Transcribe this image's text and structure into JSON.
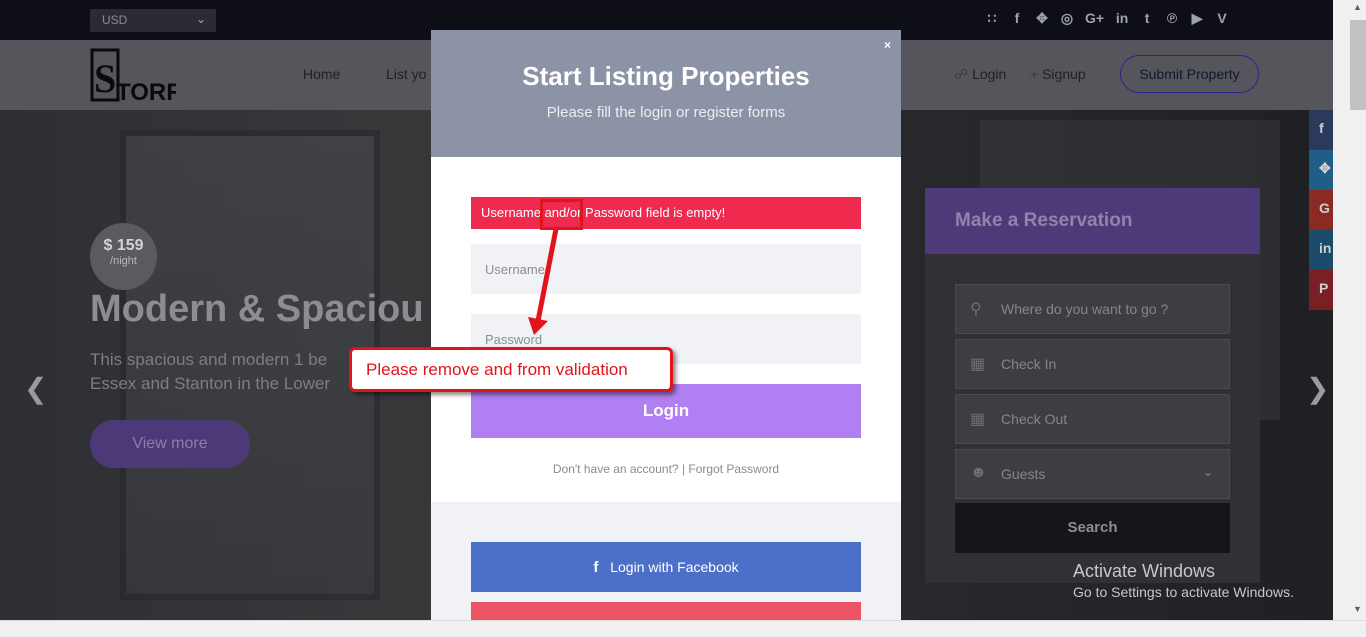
{
  "topbar": {
    "currency": "USD",
    "socials": [
      "rss-icon",
      "facebook-icon",
      "twitter-icon",
      "dribbble-icon",
      "google-plus-icon",
      "linkedin-icon",
      "tumblr-icon",
      "pinterest-icon",
      "youtube-icon",
      "vimeo-icon"
    ]
  },
  "nav": {
    "logo_text": "STORR",
    "items": [
      "Home",
      "List yo"
    ],
    "login": "Login",
    "signup": "Signup",
    "submit": "Submit Property"
  },
  "hero": {
    "price": "$ 159",
    "per": "/night",
    "title": "Modern & Spaciou",
    "text_line1": "This spacious and modern 1 be",
    "text_line2": "Essex and Stanton in the Lower",
    "button": "View more"
  },
  "reservation": {
    "title": "Make a Reservation",
    "location_placeholder": "Where do you want to go ?",
    "checkin": "Check In",
    "checkout": "Check Out",
    "guests": "Guests",
    "search": "Search"
  },
  "modal": {
    "title": "Start Listing Properties",
    "subtitle": "Please fill the login or register forms",
    "close": "×",
    "error": "Username and/or Password field is empty!",
    "username_placeholder": "Username",
    "password_placeholder": "Password",
    "login": "Login",
    "no_account": "Don't have an account?",
    "separator": "|",
    "forgot": "Forgot Password",
    "facebook": "Login with Facebook"
  },
  "annotation": {
    "callout": "Please remove and from validation"
  },
  "windows": {
    "line1": "Activate Windows",
    "line2": "Go to Settings to activate Windows."
  },
  "colors": {
    "accent": "#b07ff2",
    "error": "#f0294f",
    "facebook": "#4c6fc8",
    "annotation": "#e3131b"
  }
}
